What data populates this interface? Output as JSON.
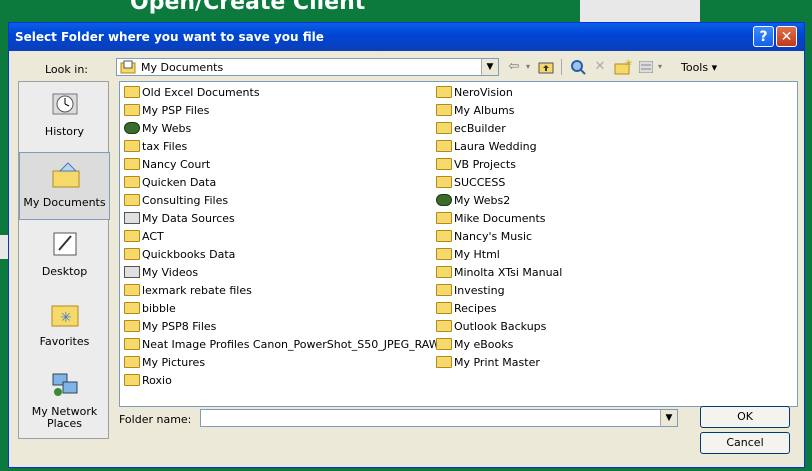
{
  "background": {
    "title": "Open/Create Client"
  },
  "window": {
    "title": "Select Folder where you want to save you file",
    "help": "?",
    "close": "✕"
  },
  "lookin": {
    "label": "Look in:",
    "value": "My Documents"
  },
  "toolbar": {
    "tools_label": "Tools ▾"
  },
  "places": [
    {
      "label": "History"
    },
    {
      "label": "My Documents"
    },
    {
      "label": "Desktop"
    },
    {
      "label": "Favorites"
    },
    {
      "label": "My Network Places"
    }
  ],
  "files_left": [
    {
      "name": "Old Excel Documents",
      "icon": "folder"
    },
    {
      "name": "My PSP Files",
      "icon": "folder"
    },
    {
      "name": "My Webs",
      "icon": "web-folder"
    },
    {
      "name": "tax Files",
      "icon": "folder"
    },
    {
      "name": "Nancy Court",
      "icon": "folder"
    },
    {
      "name": "Quicken Data",
      "icon": "folder"
    },
    {
      "name": "Consulting Files",
      "icon": "folder"
    },
    {
      "name": "My Data Sources",
      "icon": "data-sources"
    },
    {
      "name": "ACT",
      "icon": "folder"
    },
    {
      "name": "Quickbooks Data",
      "icon": "folder"
    },
    {
      "name": "My Videos",
      "icon": "video-folder"
    },
    {
      "name": "lexmark rebate files",
      "icon": "folder"
    },
    {
      "name": "bibble",
      "icon": "folder"
    },
    {
      "name": "My PSP8 Files",
      "icon": "folder"
    },
    {
      "name": "Neat Image Profiles Canon_PowerShot_S50_JPEG_RAW",
      "icon": "folder"
    },
    {
      "name": "My Pictures",
      "icon": "folder"
    },
    {
      "name": "Roxio",
      "icon": "folder"
    }
  ],
  "files_right": [
    {
      "name": "NeroVision",
      "icon": "folder"
    },
    {
      "name": "My Albums",
      "icon": "folder"
    },
    {
      "name": "ecBuilder",
      "icon": "folder"
    },
    {
      "name": "Laura Wedding",
      "icon": "folder"
    },
    {
      "name": "VB Projects",
      "icon": "folder"
    },
    {
      "name": "SUCCESS",
      "icon": "folder"
    },
    {
      "name": "My Webs2",
      "icon": "web-folder"
    },
    {
      "name": "Mike Documents",
      "icon": "folder"
    },
    {
      "name": "Nancy's Music",
      "icon": "music-folder"
    },
    {
      "name": "My Html",
      "icon": "folder"
    },
    {
      "name": "Minolta XTsi Manual",
      "icon": "folder"
    },
    {
      "name": "Investing",
      "icon": "folder"
    },
    {
      "name": "Recipes",
      "icon": "folder"
    },
    {
      "name": "Outlook Backups",
      "icon": "folder"
    },
    {
      "name": "My eBooks",
      "icon": "folder"
    },
    {
      "name": "My Print Master",
      "icon": "folder"
    }
  ],
  "foldername": {
    "label": "Folder name:",
    "value": ""
  },
  "buttons": {
    "ok": "OK",
    "cancel": "Cancel"
  }
}
